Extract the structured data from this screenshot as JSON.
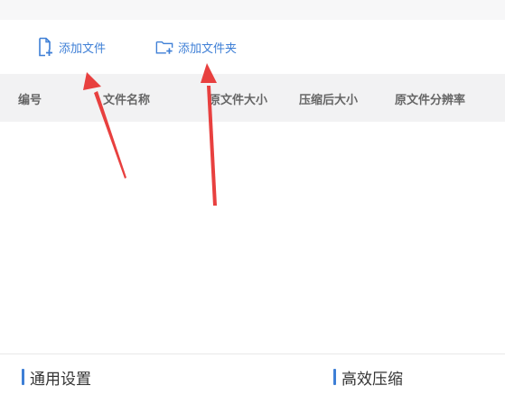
{
  "toolbar": {
    "add_file_label": "添加文件",
    "add_folder_label": "添加文件夹",
    "add_file_icon": "file-add-icon",
    "add_folder_icon": "folder-add-icon"
  },
  "table": {
    "columns": [
      "编号",
      "文件名称",
      "原文件大小",
      "压缩后大小",
      "原文件分辨率"
    ]
  },
  "sections": {
    "general_settings": "通用设置",
    "efficient_compress": "高效压缩"
  },
  "colors": {
    "accent": "#3e7fd6",
    "annotation_arrow": "#e8403f"
  }
}
